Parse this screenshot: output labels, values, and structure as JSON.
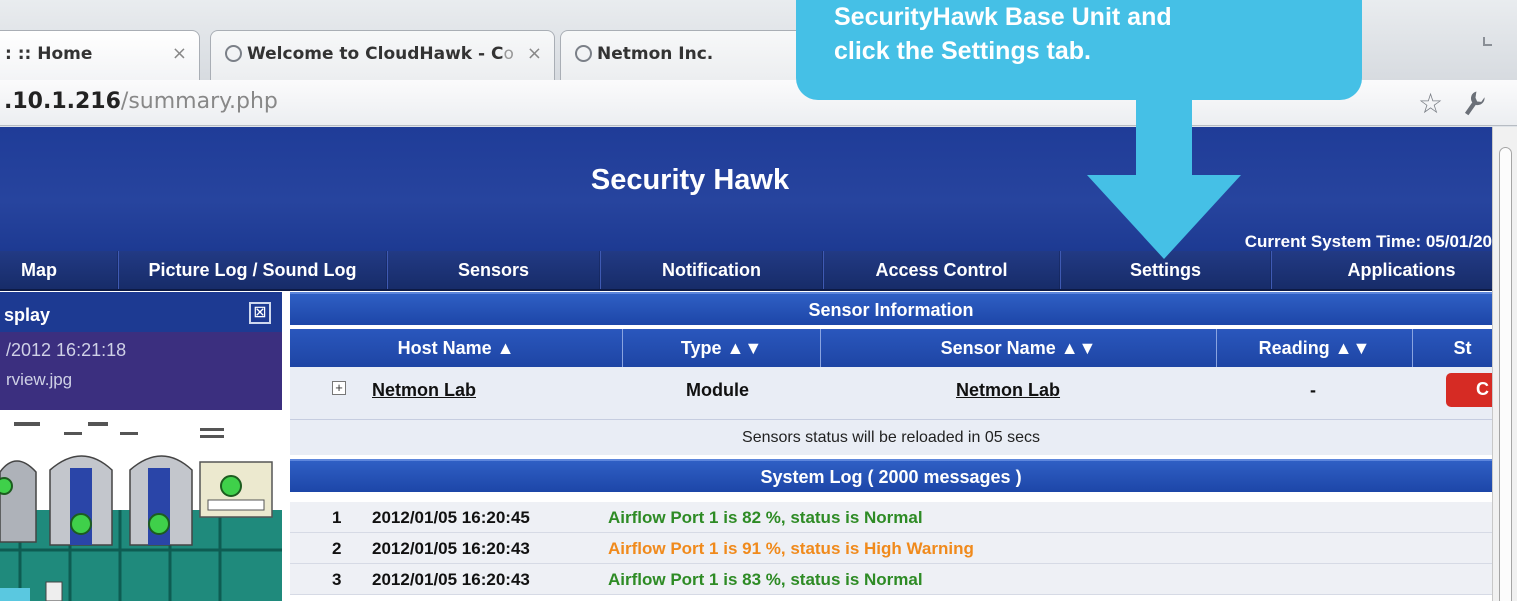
{
  "browser": {
    "tabs": [
      {
        "label": ": :: Home",
        "close": "×"
      },
      {
        "label": "Welcome to CloudHawk - C",
        "label_faded": "o",
        "close": "×"
      },
      {
        "label": "Netmon Inc."
      }
    ],
    "url_host": ".10.1.216",
    "url_path": "/summary.php",
    "star_icon": "☆",
    "wrench_icon": "🔧"
  },
  "callout": {
    "line1": "SecurityHawk Base Unit and",
    "line2": "click the Settings tab."
  },
  "header": {
    "title": "Security Hawk",
    "system_time": "Current System Time: 05/01/20"
  },
  "nav": [
    "Map",
    "Picture Log / Sound Log",
    "Sensors",
    "Notification",
    "Access Control",
    "Settings",
    "Applications"
  ],
  "left_panel": {
    "title": "splay",
    "close": "⊠",
    "datetime": "/2012 16:21:18",
    "filename": "rview.jpg"
  },
  "sensor_info": {
    "title": "Sensor Information",
    "columns": [
      "Host Name ▲",
      "Type ▲▼",
      "Sensor Name ▲▼",
      "Reading ▲▼",
      "St"
    ],
    "rows": [
      {
        "expand": "+",
        "host": "Netmon Lab",
        "type": "Module",
        "sensor": "Netmon Lab",
        "reading": "-",
        "status": "C"
      }
    ],
    "reload_text": "Sensors status will be reloaded in 05 secs"
  },
  "system_log": {
    "title": "System Log ( 2000 messages )",
    "entries": [
      {
        "num": "1",
        "time": "2012/01/05 16:20:45",
        "msg": "Airflow Port 1 is 82 %, status is Normal",
        "color": "#2e8b25"
      },
      {
        "num": "2",
        "time": "2012/01/05 16:20:43",
        "msg": "Airflow Port 1 is 91 %, status is High Warning",
        "color": "#f08a1c"
      },
      {
        "num": "3",
        "time": "2012/01/05 16:20:43",
        "msg": "Airflow Port 1 is 83 %, status is Normal",
        "color": "#2e8b25"
      }
    ]
  },
  "colors": {
    "header_blue": "#27449e",
    "callout": "#45c0e6",
    "status_red": "#d62b24"
  }
}
